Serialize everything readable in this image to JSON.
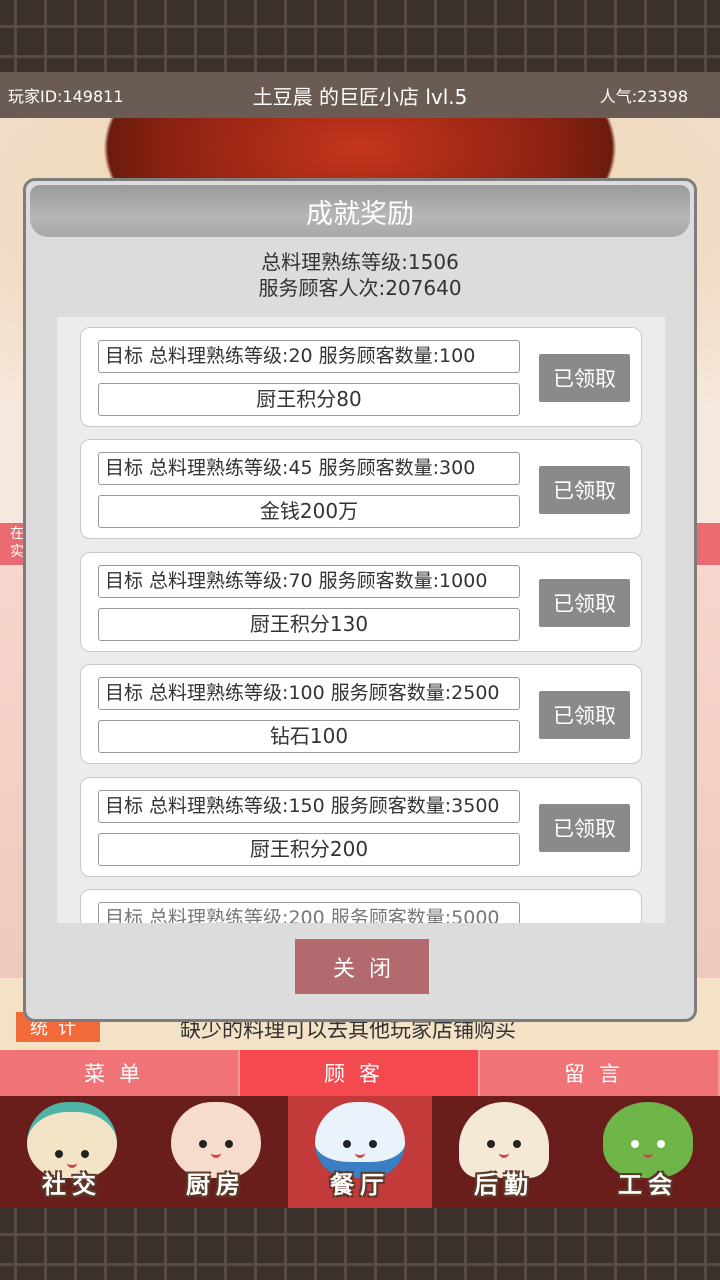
{
  "header": {
    "player_id": "玩家ID:149811",
    "shop_title": "土豆晨 的巨匠小店 lvl.5",
    "popularity": "人气:23398"
  },
  "background": {
    "side_strip_text": "在\n实"
  },
  "modal": {
    "title": "成就奖励",
    "summary_level": "总料理熟练等级:1506",
    "summary_customers": "服务顾客人次:207640",
    "achievements": [
      {
        "goal": "目标  总料理熟练等级:20  服务顾客数量:100",
        "reward": "厨王积分80",
        "button": "已领取"
      },
      {
        "goal": "目标  总料理熟练等级:45  服务顾客数量:300",
        "reward": "金钱200万",
        "button": "已领取"
      },
      {
        "goal": "目标  总料理熟练等级:70  服务顾客数量:1000",
        "reward": "厨王积分130",
        "button": "已领取"
      },
      {
        "goal": "目标  总料理熟练等级:100  服务顾客数量:2500",
        "reward": "钻石100",
        "button": "已领取"
      },
      {
        "goal": "目标  总料理熟练等级:150  服务顾客数量:3500",
        "reward": "厨王积分200",
        "button": "已领取"
      }
    ],
    "partial_goal": "目标  总料理熟练等级:200  服务顾客数量:5000",
    "close_label": "关闭"
  },
  "stats_tag": "统计",
  "hint": "缺少的料理可以去其他玩家店铺购买",
  "tabs": [
    {
      "label": "菜单",
      "active": false
    },
    {
      "label": "顾客",
      "active": true
    },
    {
      "label": "留言",
      "active": false
    }
  ],
  "bottom_nav": [
    {
      "label": "社交",
      "icon": "noodle-bowl-icon",
      "color": "#f3e4c8"
    },
    {
      "label": "厨房",
      "icon": "steamed-bun-icon",
      "color": "#f7dccd"
    },
    {
      "label": "餐厅",
      "icon": "rice-bowl-icon",
      "color": "#eaf2fb",
      "active": true
    },
    {
      "label": "后勤",
      "icon": "dumpling-icon",
      "color": "#f3e9d6"
    },
    {
      "label": "工会",
      "icon": "zongzi-icon",
      "color": "#6fb54a"
    }
  ]
}
